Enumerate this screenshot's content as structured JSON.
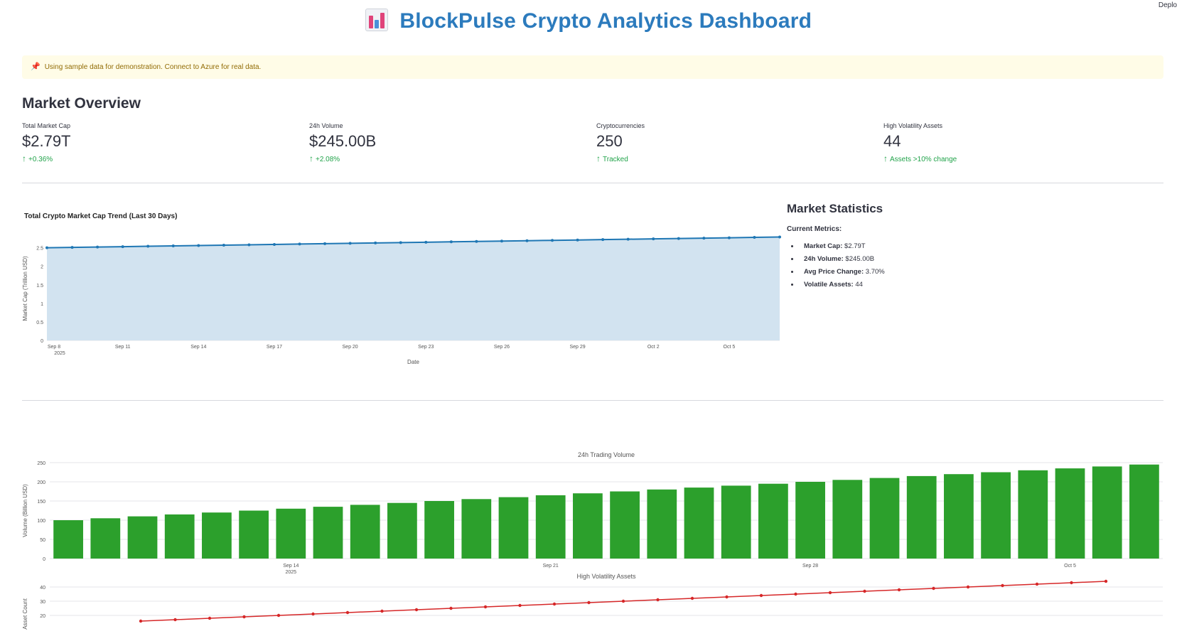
{
  "header": {
    "deploy_label": "Deplo",
    "title": "BlockPulse Crypto Analytics Dashboard",
    "icon": "bar-chart-icon"
  },
  "banner": {
    "icon": "pushpin-icon",
    "text": "Using sample data for demonstration. Connect to Azure for real data."
  },
  "overview": {
    "heading": "Market Overview",
    "metrics": [
      {
        "label": "Total Market Cap",
        "value": "$2.79T",
        "delta": "+0.36%"
      },
      {
        "label": "24h Volume",
        "value": "$245.00B",
        "delta": "+2.08%"
      },
      {
        "label": "Cryptocurrencies",
        "value": "250",
        "delta": "Tracked"
      },
      {
        "label": "High Volatility Assets",
        "value": "44",
        "delta": "Assets >10% change"
      }
    ]
  },
  "stats": {
    "heading": "Market Statistics",
    "subheading": "Current Metrics:",
    "items": [
      {
        "key": "Market Cap:",
        "val": "$2.79T"
      },
      {
        "key": "24h Volume:",
        "val": "$245.00B"
      },
      {
        "key": "Avg Price Change:",
        "val": "3.70%"
      },
      {
        "key": "Volatile Assets:",
        "val": "44"
      }
    ]
  },
  "colors": {
    "accent": "#2c7bbd",
    "positive": "#21a34a",
    "volume_bar": "#2ca02c",
    "volatility_line": "#d62728",
    "area_fill": "#d2e3f0",
    "line": "#1f77b4"
  },
  "chart_data": [
    {
      "type": "area",
      "title": "Total Crypto Market Cap Trend (Last 30 Days)",
      "xlabel": "Date",
      "ylabel": "Market Cap (Trillion USD)",
      "x_ticks": [
        "Sep 8",
        "Sep 11",
        "Sep 14",
        "Sep 17",
        "Sep 20",
        "Sep 23",
        "Sep 26",
        "Sep 29",
        "Oct 2",
        "Oct 5"
      ],
      "x_tick_year": "2025",
      "y_ticks": [
        "0",
        "0.5",
        "1",
        "1.5",
        "2",
        "2.5"
      ],
      "ylim": [
        0,
        2.8
      ],
      "grid": true,
      "series": [
        {
          "values": [
            2.5,
            2.51,
            2.52,
            2.53,
            2.54,
            2.55,
            2.56,
            2.57,
            2.58,
            2.59,
            2.6,
            2.61,
            2.62,
            2.63,
            2.64,
            2.65,
            2.66,
            2.67,
            2.68,
            2.69,
            2.7,
            2.71,
            2.72,
            2.73,
            2.74,
            2.75,
            2.76,
            2.77,
            2.78,
            2.79
          ]
        }
      ]
    },
    {
      "type": "bar",
      "title": "24h Trading Volume",
      "ylabel": "Volume (Billion USD)",
      "x_ticks": [
        "Sep 14",
        "Sep 21",
        "Sep 28",
        "Oct 5"
      ],
      "x_tick_year": "2025",
      "y_ticks": [
        "0",
        "50",
        "100",
        "150",
        "200",
        "250"
      ],
      "ylim": [
        0,
        250
      ],
      "grid": true,
      "series": [
        {
          "values": [
            100,
            105,
            110,
            115,
            120,
            125,
            130,
            135,
            140,
            145,
            150,
            155,
            160,
            165,
            170,
            175,
            180,
            185,
            190,
            195,
            200,
            205,
            210,
            215,
            220,
            225,
            230,
            235,
            240,
            245
          ]
        }
      ]
    },
    {
      "type": "line",
      "title": "High Volatility Assets",
      "ylabel": "Asset Count",
      "y_ticks": [
        "20",
        "30",
        "40"
      ],
      "ylim": [
        15,
        45
      ],
      "grid": true,
      "series": [
        {
          "values": [
            16,
            17,
            18,
            19,
            20,
            21,
            22,
            23,
            24,
            25,
            26,
            27,
            28,
            29,
            30,
            31,
            32,
            33,
            34,
            35,
            36,
            37,
            38,
            39,
            40,
            41,
            42,
            43,
            44
          ]
        }
      ]
    }
  ]
}
